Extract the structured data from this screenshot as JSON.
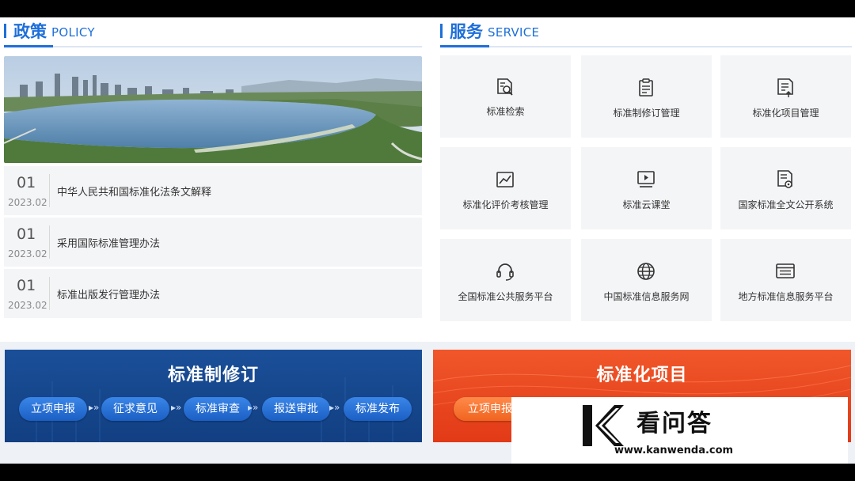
{
  "policy": {
    "title_cn": "政策",
    "title_en": "POLICY",
    "items": [
      {
        "day": "01",
        "ym": "2023.02",
        "title": "中华人民共和国标准化法条文解释"
      },
      {
        "day": "01",
        "ym": "2023.02",
        "title": "采用国际标准管理办法"
      },
      {
        "day": "01",
        "ym": "2023.02",
        "title": "标准出版发行管理办法"
      }
    ]
  },
  "service": {
    "title_cn": "服务",
    "title_en": "SERVICE",
    "items": [
      {
        "label": "标准检索",
        "icon": "document-search-icon"
      },
      {
        "label": "标准制修订管理",
        "icon": "clipboard-icon"
      },
      {
        "label": "标准化项目管理",
        "icon": "document-upload-icon"
      },
      {
        "label": "标准化评价考核管理",
        "icon": "chart-icon"
      },
      {
        "label": "标准云课堂",
        "icon": "video-play-icon"
      },
      {
        "label": "国家标准全文公开系统",
        "icon": "document-settings-icon"
      },
      {
        "label": "全国标准公共服务平台",
        "icon": "headset-icon"
      },
      {
        "label": "中国标准信息服务网",
        "icon": "globe-icon"
      },
      {
        "label": "地方标准信息服务平台",
        "icon": "browser-window-icon"
      }
    ]
  },
  "banners": {
    "revision": {
      "title": "标准制修订",
      "steps": [
        "立项申报",
        "征求意见",
        "标准审查",
        "报送审批",
        "标准发布"
      ]
    },
    "project": {
      "title": "标准化项目",
      "steps": [
        "立项申报"
      ]
    }
  },
  "watermark": {
    "brand": "看问答",
    "url": "www.kanwenda.com"
  },
  "colors": {
    "accent": "#1e6fd9",
    "banner_blue": "#1a4f98",
    "banner_red": "#e8471f",
    "tile_bg": "#f4f5f7"
  }
}
